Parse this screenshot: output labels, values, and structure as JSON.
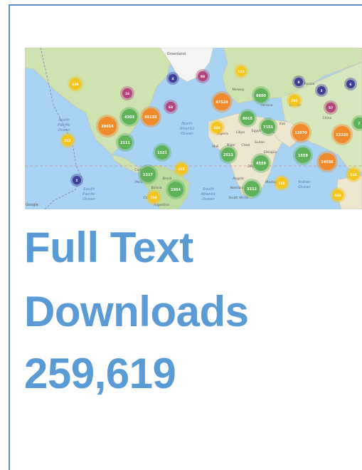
{
  "headline": {
    "line1": "Full Text",
    "line2": "Downloads",
    "line3": "259,619"
  },
  "map": {
    "region_labels": [
      {
        "id": "greenland",
        "text": "Greenland"
      },
      {
        "id": "npo1",
        "text": "North"
      },
      {
        "id": "npo2",
        "text": "Pacific"
      },
      {
        "id": "npo3",
        "text": "Ocean"
      },
      {
        "id": "nao1",
        "text": "North"
      },
      {
        "id": "nao2",
        "text": "Atlantic"
      },
      {
        "id": "nao3",
        "text": "Ocean"
      },
      {
        "id": "spo1",
        "text": "South"
      },
      {
        "id": "spo2",
        "text": "Pacific"
      },
      {
        "id": "spo3",
        "text": "Ocean"
      },
      {
        "id": "sao1",
        "text": "South"
      },
      {
        "id": "sao2",
        "text": "Atlantic"
      },
      {
        "id": "sao3",
        "text": "Ocean"
      },
      {
        "id": "io1",
        "text": "Indian"
      },
      {
        "id": "io2",
        "text": "Ocean"
      },
      {
        "id": "norway",
        "text": "Norway"
      },
      {
        "id": "russia",
        "text": "Russia"
      },
      {
        "id": "ukraine",
        "text": "Ukraine"
      },
      {
        "id": "kazakh",
        "text": "Kazakh"
      },
      {
        "id": "algeria",
        "text": "Algeria"
      },
      {
        "id": "libya",
        "text": "Libya"
      },
      {
        "id": "egypt",
        "text": "Egypt"
      },
      {
        "id": "mali",
        "text": "Mali"
      },
      {
        "id": "niger",
        "text": "Niger"
      },
      {
        "id": "chad",
        "text": "Chad"
      },
      {
        "id": "sudan",
        "text": "Sudan"
      },
      {
        "id": "ethiopia",
        "text": "Ethiopia"
      },
      {
        "id": "china",
        "text": "China"
      },
      {
        "id": "iran",
        "text": "Iran"
      },
      {
        "id": "saudi",
        "text": "Saudi"
      },
      {
        "id": "drc",
        "text": "DRC"
      },
      {
        "id": "angola",
        "text": "Angola"
      },
      {
        "id": "namibia",
        "text": "Namibia"
      },
      {
        "id": "southafrica",
        "text": "South Africa"
      },
      {
        "id": "madagascar",
        "text": "Madagascar"
      },
      {
        "id": "peru",
        "text": "Peru"
      },
      {
        "id": "brazil",
        "text": "Brazil"
      },
      {
        "id": "colombia",
        "text": "Colombia"
      },
      {
        "id": "bolivia",
        "text": "Bolivia"
      },
      {
        "id": "chile",
        "text": "Chile"
      },
      {
        "id": "argentina",
        "text": "Argentina"
      },
      {
        "id": "google",
        "text": "Google"
      }
    ],
    "clusters": [
      {
        "label": "139",
        "color": "#f6c51c"
      },
      {
        "label": "16",
        "color": "#b2447e"
      },
      {
        "label": "4",
        "color": "#3e3e98"
      },
      {
        "label": "98",
        "color": "#b2447e"
      },
      {
        "label": "113",
        "color": "#f6c51c"
      },
      {
        "label": "63",
        "color": "#b2447e"
      },
      {
        "label": "4303",
        "color": "#5fb25a"
      },
      {
        "label": "85135",
        "color": "#f08a2a"
      },
      {
        "label": "39654",
        "color": "#f08a2a"
      },
      {
        "label": "2111",
        "color": "#5fb25a"
      },
      {
        "label": "212",
        "color": "#f6c51c"
      },
      {
        "label": "1521",
        "color": "#5fb25a"
      },
      {
        "label": "1317",
        "color": "#5fb25a"
      },
      {
        "label": "115",
        "color": "#f6c51c"
      },
      {
        "label": "2954",
        "color": "#5fb25a"
      },
      {
        "label": "750",
        "color": "#f6c51c"
      },
      {
        "label": "5",
        "color": "#3e3e98"
      },
      {
        "label": "47529",
        "color": "#f08a2a"
      },
      {
        "label": "6600",
        "color": "#5fb25a"
      },
      {
        "label": "8015",
        "color": "#5fb25a"
      },
      {
        "label": "324",
        "color": "#f6c51c"
      },
      {
        "label": "7151",
        "color": "#5fb25a"
      },
      {
        "label": "235",
        "color": "#f6c51c"
      },
      {
        "label": "12070",
        "color": "#f08a2a"
      },
      {
        "label": "12220",
        "color": "#f08a2a"
      },
      {
        "label": "2511",
        "color": "#5fb25a"
      },
      {
        "label": "4559",
        "color": "#5fb25a"
      },
      {
        "label": "1559",
        "color": "#5fb25a"
      },
      {
        "label": "14556",
        "color": "#f08a2a"
      },
      {
        "label": "3212",
        "color": "#5fb25a"
      },
      {
        "label": "325",
        "color": "#f6c51c"
      },
      {
        "label": "114",
        "color": "#f6c51c"
      },
      {
        "label": "330",
        "color": "#f6c51c"
      },
      {
        "label": "57",
        "color": "#b2447e"
      },
      {
        "label": "9",
        "color": "#3e3e98"
      },
      {
        "label": "3",
        "color": "#3e3e98"
      },
      {
        "label": "6",
        "color": "#3e3e98"
      },
      {
        "label": "7",
        "color": "#5fb25a"
      }
    ]
  },
  "colors": {
    "text_accent": "#5b9bd5",
    "frame_border": "#5a8fc9",
    "ocean": "#a9d3f2",
    "land": "#e8e4d6",
    "vegetation": "#b9d9a0"
  }
}
